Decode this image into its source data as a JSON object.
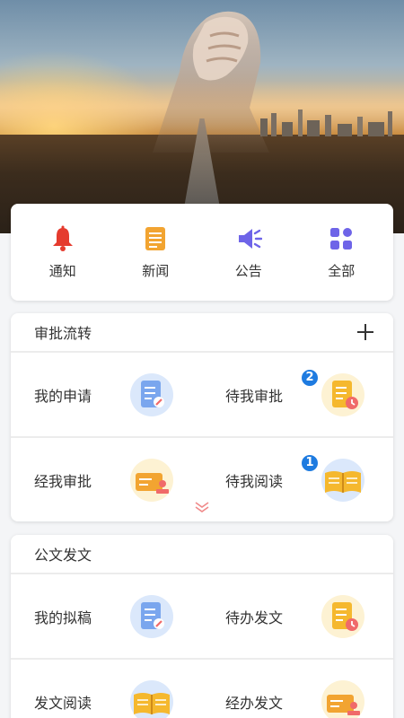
{
  "quick_menu": [
    {
      "label": "通知",
      "icon": "bell-icon",
      "color": "#e53b2e"
    },
    {
      "label": "新闻",
      "icon": "news-icon",
      "color": "#f2a431"
    },
    {
      "label": "公告",
      "icon": "megaphone-icon",
      "color": "#6e64e8"
    },
    {
      "label": "全部",
      "icon": "grid-icon",
      "color": "#6e64e8"
    }
  ],
  "approval_section": {
    "title": "审批流转",
    "items": [
      {
        "label": "我的申请",
        "icon": "application-icon"
      },
      {
        "label": "待我审批",
        "icon": "pending-approval-icon",
        "badge": "2"
      },
      {
        "label": "经我审批",
        "icon": "approved-by-me-icon"
      },
      {
        "label": "待我阅读",
        "icon": "pending-reading-icon",
        "badge": "1"
      }
    ]
  },
  "document_section": {
    "title": "公文发文",
    "items": [
      {
        "label": "我的拟稿",
        "icon": "my-draft-icon"
      },
      {
        "label": "待办发文",
        "icon": "pending-dispatch-icon"
      },
      {
        "label": "发文阅读",
        "icon": "dispatch-reading-icon"
      },
      {
        "label": "经办发文",
        "icon": "handled-dispatch-icon"
      }
    ]
  },
  "colors": {
    "badge": "#1e7be0",
    "accent_red": "#e53b2e",
    "accent_purple": "#6e64e8",
    "accent_orange": "#f2a431"
  }
}
